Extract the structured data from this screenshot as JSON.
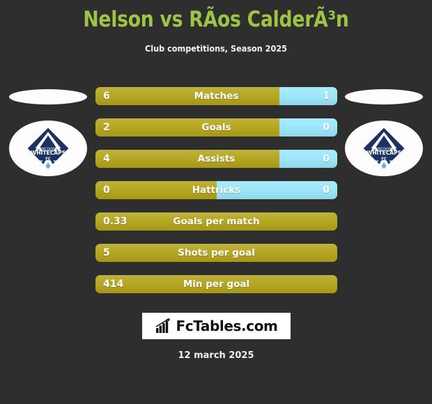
{
  "header": {
    "title": "Nelson vs RÃ­os CalderÃ³n",
    "subtitle": "Club competitions, Season 2025"
  },
  "colors": {
    "background": "#2e2e2e",
    "title_green": "#9dc444",
    "home_gold": "#b3a41a",
    "away_blue": "#9ae6fa",
    "text_white": "#ffffff"
  },
  "badges": {
    "left": {
      "name": "Vancouver Whitecaps FC",
      "line1": "VANCOUVER",
      "line2": "WHITECAPS",
      "line3": "FC"
    },
    "right": {
      "name": "Vancouver Whitecaps FC",
      "line1": "VANCOUVER",
      "line2": "WHITECAPS",
      "line3": "FC"
    }
  },
  "stats": [
    {
      "label": "Matches",
      "home": "6",
      "away": "1",
      "home_pct": 76,
      "dual": true
    },
    {
      "label": "Goals",
      "home": "2",
      "away": "0",
      "home_pct": 76,
      "dual": true
    },
    {
      "label": "Assists",
      "home": "4",
      "away": "0",
      "home_pct": 76,
      "dual": true
    },
    {
      "label": "Hattricks",
      "home": "0",
      "away": "0",
      "home_pct": 50,
      "dual": true
    },
    {
      "label": "Goals per match",
      "home": "0.33",
      "away": "",
      "home_pct": 100,
      "dual": false
    },
    {
      "label": "Shots per goal",
      "home": "5",
      "away": "",
      "home_pct": 100,
      "dual": false
    },
    {
      "label": "Min per goal",
      "home": "414",
      "away": "",
      "home_pct": 100,
      "dual": false
    }
  ],
  "footer": {
    "brand": "FcTables.com",
    "brand_icon": "bar-chart-arrow-icon",
    "date": "12 march 2025"
  }
}
